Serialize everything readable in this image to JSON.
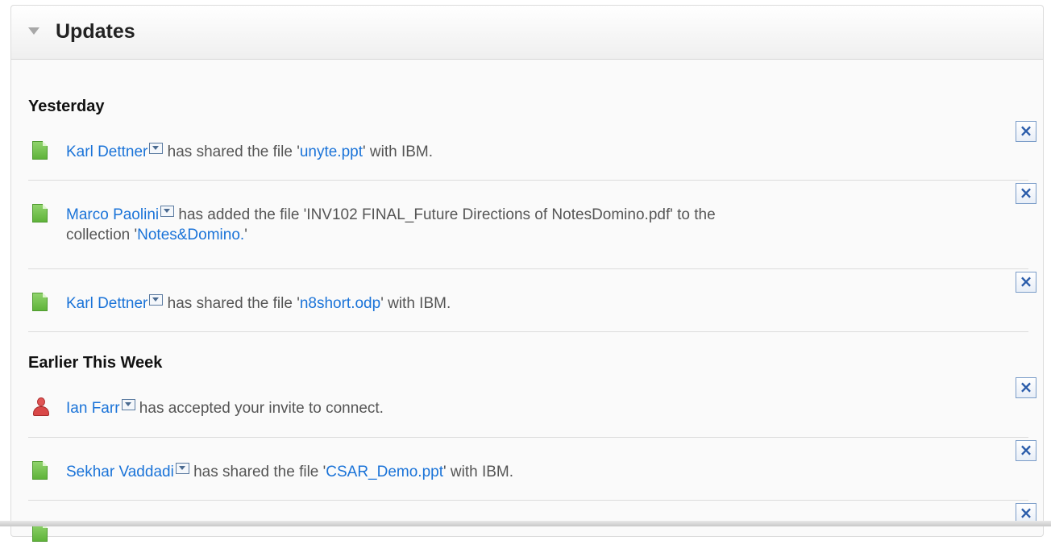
{
  "panel": {
    "title": "Updates"
  },
  "sections": [
    {
      "heading": "Yesterday",
      "entries": [
        {
          "icon": "file-icon",
          "actor": "Karl Dettner",
          "text_before": " has shared the file '",
          "link": "unyte.ppt",
          "text_after": "' with IBM.",
          "text_line2": ""
        },
        {
          "icon": "file-icon",
          "actor": "Marco Paolini",
          "text_before": " has added the file 'INV102 FINAL_Future Directions of NotesDomino.pdf' to the",
          "link": "",
          "text_after": "",
          "text_line2_before": "collection '",
          "text_line2_link": "Notes&Domino.",
          "text_line2_after": "'"
        },
        {
          "icon": "file-icon",
          "actor": "Karl Dettner",
          "text_before": " has shared the file '",
          "link": "n8short.odp",
          "text_after": "' with IBM."
        }
      ]
    },
    {
      "heading": "Earlier This Week",
      "entries": [
        {
          "icon": "person-icon",
          "actor": "Ian Farr",
          "text_before": " has accepted your invite to connect.",
          "link": "",
          "text_after": ""
        },
        {
          "icon": "file-icon",
          "actor": "Sekhar Vaddadi",
          "text_before": " has shared the file '",
          "link": "CSAR_Demo.ppt",
          "text_after": "' with IBM."
        }
      ]
    }
  ],
  "dismiss_label": "×",
  "colors": {
    "link": "#1a73d8",
    "file_icon": "#6fc24a",
    "person_icon": "#d94848"
  }
}
